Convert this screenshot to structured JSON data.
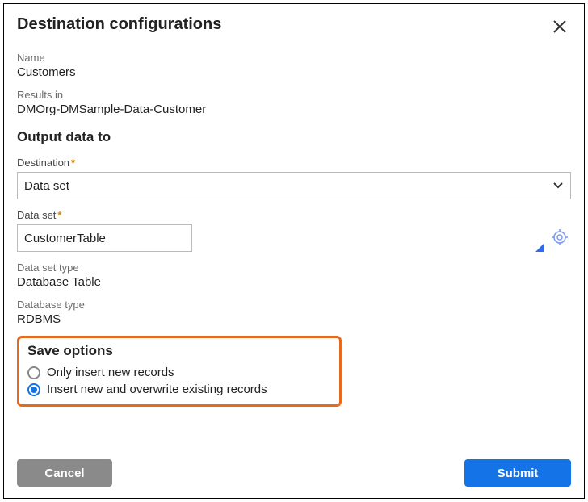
{
  "dialog": {
    "title": "Destination configurations",
    "name_label": "Name",
    "name_value": "Customers",
    "results_in_label": "Results in",
    "results_in_value": "DMOrg-DMSample-Data-Customer",
    "output_heading": "Output data to",
    "destination_label": "Destination",
    "destination_value": "Data set",
    "dataset_label": "Data set",
    "dataset_value": "CustomerTable",
    "dataset_type_label": "Data set type",
    "dataset_type_value": "Database Table",
    "database_type_label": "Database type",
    "database_type_value": "RDBMS",
    "save_options_heading": "Save options",
    "radio_insert_label": "Only insert new records",
    "radio_overwrite_label": "Insert new and overwrite existing records"
  },
  "buttons": {
    "cancel": "Cancel",
    "submit": "Submit"
  }
}
